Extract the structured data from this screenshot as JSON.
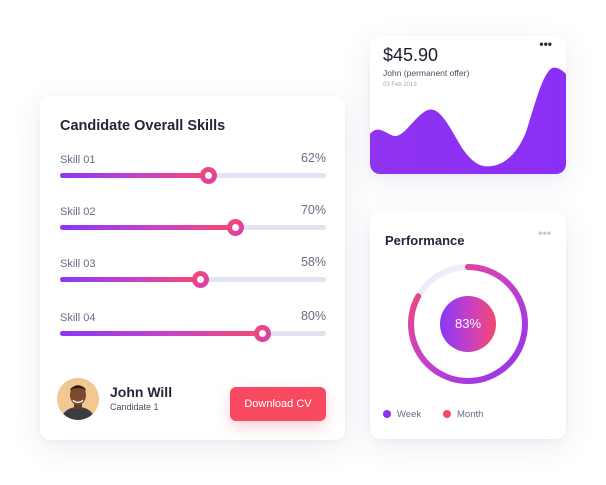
{
  "skills_card": {
    "title": "Candidate Overall Skills",
    "skills": [
      {
        "name": "Skill 01",
        "percent_label": "62%",
        "slider_fraction": 0.56
      },
      {
        "name": "Skill 02",
        "percent_label": "70%",
        "slider_fraction": 0.66
      },
      {
        "name": "Skill 03",
        "percent_label": "58%",
        "slider_fraction": 0.53
      },
      {
        "name": "Skill 04",
        "percent_label": "80%",
        "slider_fraction": 0.76
      }
    ],
    "candidate_name": "John Will",
    "candidate_subtitle": "Candidate 1",
    "download_label": "Download CV"
  },
  "price_card": {
    "amount": "$45.90",
    "subtitle": "John (permanent offer)",
    "date": "03 Feb 2019",
    "more_label": "•••"
  },
  "performance_card": {
    "title": "Performance",
    "more_label": "•••",
    "value_label": "83%",
    "value_fraction": 0.83,
    "legend": [
      {
        "label": "Week",
        "color": "#8a35f2"
      },
      {
        "label": "Month",
        "color": "#f4496c"
      }
    ]
  },
  "colors": {
    "accent_purple": "#8a38f5",
    "accent_pink": "#f6496e",
    "button_red": "#f74a61",
    "track_light": "#e3e1f4"
  }
}
